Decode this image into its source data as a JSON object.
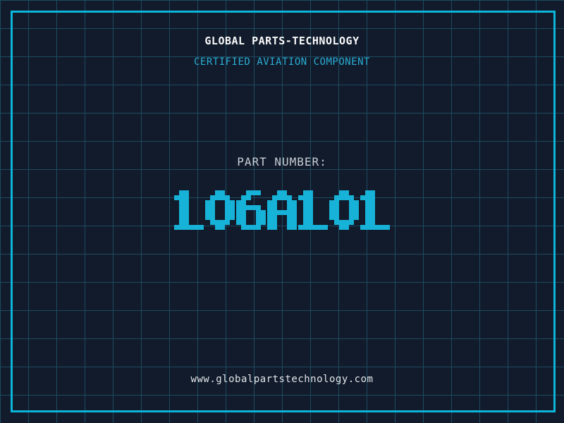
{
  "header": {
    "title": "GLOBAL PARTS-TECHNOLOGY",
    "subtitle": "CERTIFIED AVIATION COMPONENT"
  },
  "part": {
    "label": "PART NUMBER:",
    "number": "106A101"
  },
  "footer": {
    "website": "www.globalpartstechnology.com"
  },
  "colors": {
    "background": "#111b2b",
    "grid_line": "#1d4a60",
    "frame": "#0cb5da",
    "title_text": "#fafafa",
    "subtitle_text": "#2bacd4",
    "label_text": "#c9ced6",
    "part_number": "#17b2d7",
    "url_text": "#e3e6ea"
  }
}
